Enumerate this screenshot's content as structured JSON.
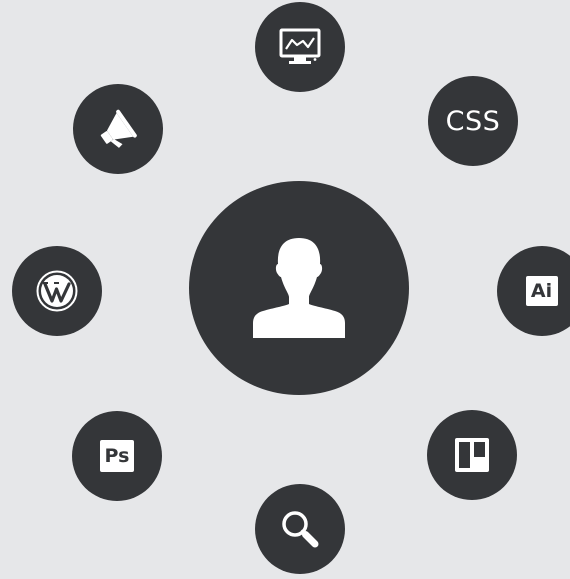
{
  "colors": {
    "background": "#e6e7e9",
    "node": "#343639",
    "icon": "#ffffff"
  },
  "center": {
    "icon": "user-silhouette-icon"
  },
  "nodes": [
    {
      "id": "monitor",
      "icon": "analytics-monitor-icon"
    },
    {
      "id": "css",
      "icon": "css-icon",
      "label": "CSS"
    },
    {
      "id": "illustrator",
      "icon": "adobe-illustrator-icon",
      "label": "Ai"
    },
    {
      "id": "trello",
      "icon": "board-icon"
    },
    {
      "id": "search",
      "icon": "search-icon"
    },
    {
      "id": "photoshop",
      "icon": "adobe-photoshop-icon",
      "label": "Ps"
    },
    {
      "id": "wordpress",
      "icon": "wordpress-icon"
    },
    {
      "id": "megaphone",
      "icon": "megaphone-icon"
    }
  ]
}
